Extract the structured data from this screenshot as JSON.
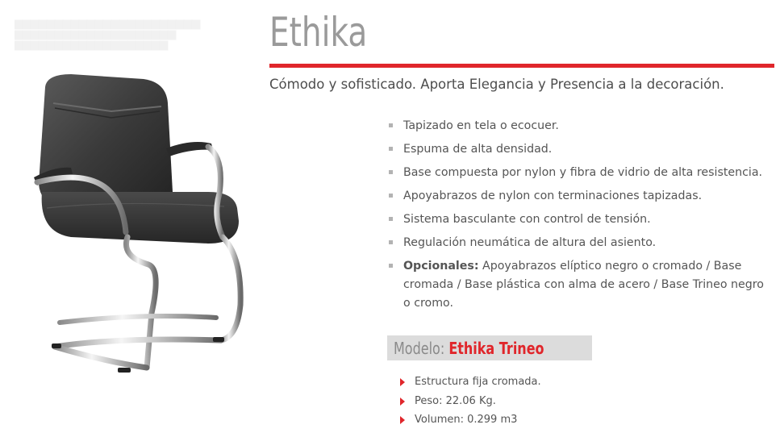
{
  "product": {
    "title": "Ethika",
    "tagline": "Cómodo y sofisticado. Aporta Elegancia y Presencia a la decoración."
  },
  "features": [
    "Tapizado en tela o ecocuer.",
    "Espuma de alta densidad.",
    "Base compuesta por nylon y fibra de vidrio de alta resistencia.",
    "Apoyabrazos de nylon con terminaciones tapizadas.",
    "Sistema basculante con control de tensión.",
    "Regulación neumática de altura del asiento."
  ],
  "optionals": {
    "label": "Opcionales:",
    "text": " Apoyabrazos elíptico negro o cromado / Base cromada / Base plástica con alma de acero / Base Trineo negro o cromo."
  },
  "model": {
    "label": "Modelo:",
    "name": "Ethika Trineo"
  },
  "specs": [
    "Estructura fija cromada.",
    "Peso: 22.06 Kg.",
    "Volumen: 0.299 m3"
  ],
  "colors": {
    "accent": "#e0262b",
    "title_gray": "#9a9a9a",
    "body_text": "#555555",
    "model_bar_bg": "#dcdcdc"
  },
  "icons": {
    "feature_bullet": "square-bullet-icon",
    "spec_bullet": "red-triangle-bullet-icon"
  },
  "image": {
    "subject": "chair-image"
  }
}
